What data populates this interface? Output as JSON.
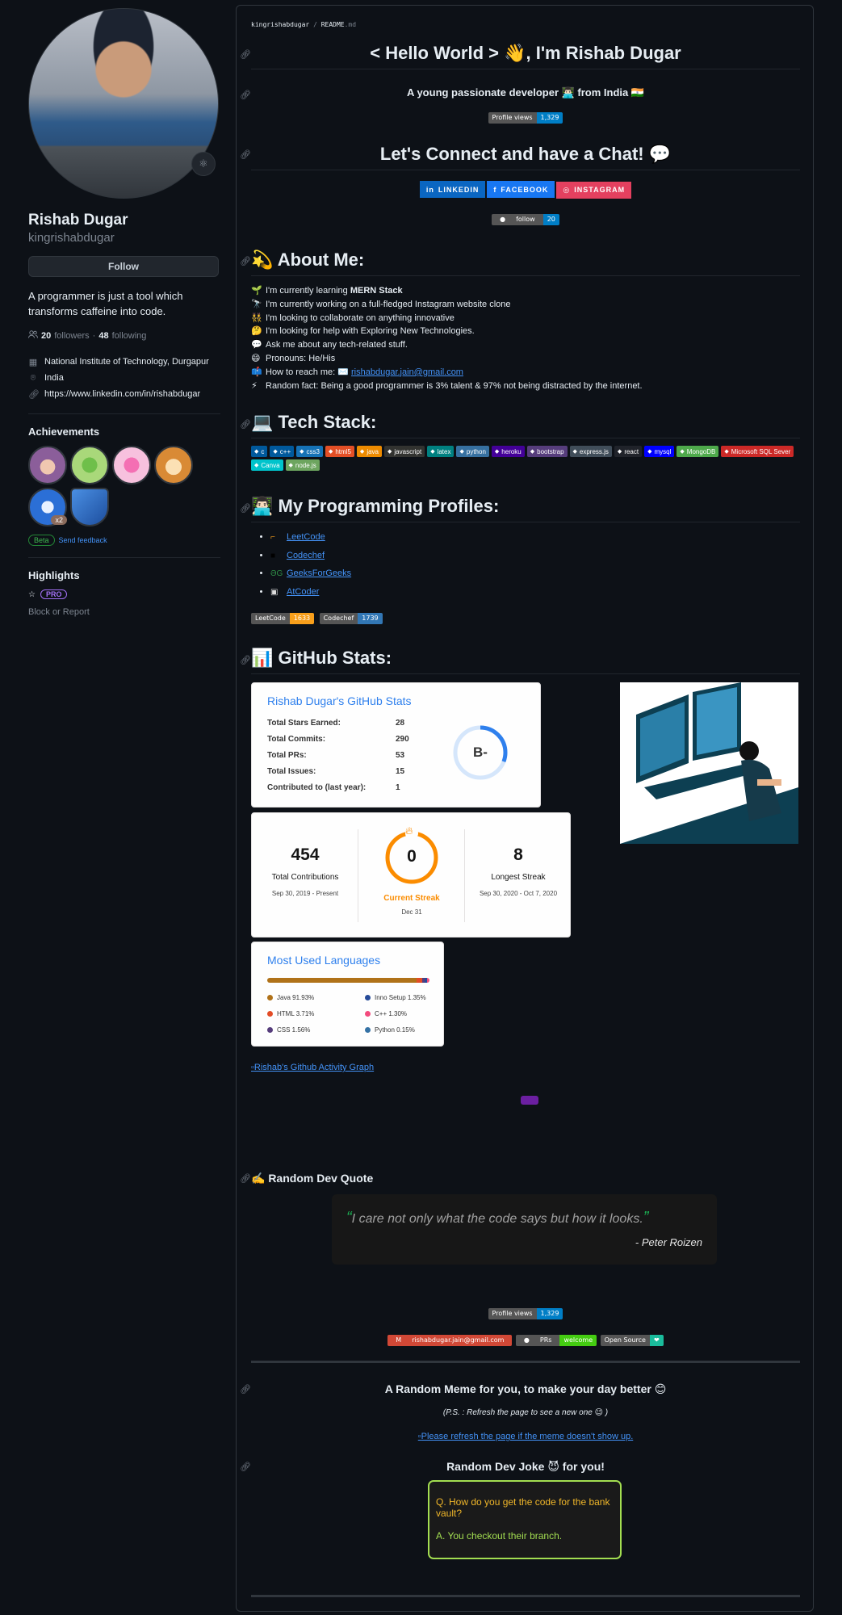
{
  "profile": {
    "name": "Rishab Dugar",
    "login": "kingrishabdugar",
    "follow_label": "Follow",
    "bio": "A programmer is just a tool which transforms caffeine into code.",
    "followers_count": "20",
    "followers_label": "followers",
    "following_count": "48",
    "following_label": "following",
    "separator": "·",
    "organization": "National Institute of Technology, Durgapur",
    "location": "India",
    "link": "https://www.linkedin.com/in/rishabdugar",
    "achievements_heading": "Achievements",
    "achievement_multiplier": "x2",
    "beta_label": "Beta",
    "feedback_label": "Send feedback",
    "highlights_heading": "Highlights",
    "pro_label": "PRO",
    "block_label": "Block or Report"
  },
  "readme": {
    "breadcrumb_user": "kingrishabdugar",
    "breadcrumb_sep": " / ",
    "breadcrumb_file": "README",
    "breadcrumb_ext": ".md",
    "hello_title": "< Hello World > 👋, I'm Rishab Dugar",
    "tagline": "A young passionate developer 👨🏻‍💻 from India 🇮🇳",
    "views_label": "Profile views",
    "views_count": "1,329",
    "connect_title": "Let's Connect and have a Chat! 💬",
    "social": [
      {
        "label": "LINKEDIN",
        "icon": "linkedin-icon",
        "color": "#0a66c2"
      },
      {
        "label": "FACEBOOK",
        "icon": "facebook-icon",
        "color": "#1877f2"
      },
      {
        "label": "INSTAGRAM",
        "icon": "instagram-icon",
        "color": "#e4405f"
      }
    ],
    "follow_badge_label": "follow",
    "follow_badge_count": "20",
    "about_title": "💫 About Me:",
    "about": [
      {
        "emoji": "🌱",
        "pre": "I'm currently learning ",
        "bold": "MERN Stack"
      },
      {
        "emoji": "🔭",
        "pre": "I'm currently working on a full-fledged Instagram website clone"
      },
      {
        "emoji": "👯",
        "pre": "I'm looking to collaborate on anything innovative"
      },
      {
        "emoji": "🤔",
        "pre": "I'm looking for help with Exploring New Technologies."
      },
      {
        "emoji": "💬",
        "pre": "Ask me about any tech-related stuff."
      },
      {
        "emoji": "😄",
        "pre": "Pronouns: He/His"
      },
      {
        "emoji": "📫",
        "pre": "How to reach me: ✉️ ",
        "link": "rishabdugar.jain@gmail.com"
      },
      {
        "emoji": "⚡",
        "pre": "Random fact: Being a good programmer is 3% talent & 97% not being distracted by the internet."
      }
    ],
    "tech_title": "💻 Tech Stack:",
    "tech": [
      {
        "label": "c",
        "color": "#00599c"
      },
      {
        "label": "c++",
        "color": "#00599c"
      },
      {
        "label": "css3",
        "color": "#1572b6"
      },
      {
        "label": "html5",
        "color": "#e34f26"
      },
      {
        "label": "java",
        "color": "#ed8b00"
      },
      {
        "label": "javascript",
        "color": "#323330"
      },
      {
        "label": "latex",
        "color": "#008080"
      },
      {
        "label": "python",
        "color": "#3670a0"
      },
      {
        "label": "heroku",
        "color": "#430098"
      },
      {
        "label": "bootstrap",
        "color": "#563d7c"
      },
      {
        "label": "express.js",
        "color": "#404d59"
      },
      {
        "label": "react",
        "color": "#20232a"
      },
      {
        "label": "mysql",
        "color": "#00f"
      },
      {
        "label": "MongoDB",
        "color": "#4ea94b"
      },
      {
        "label": "Microsoft SQL Sever",
        "color": "#cc2927"
      },
      {
        "label": "Canva",
        "color": "#00c4cc"
      },
      {
        "label": "node.js",
        "color": "#6da55f"
      }
    ],
    "profiles_title": "👨🏻‍💻 My Programming Profiles:",
    "profiles": [
      "LeetCode",
      "Codechef",
      "GeeksForGeeks",
      "AtCoder"
    ],
    "rating_badges": [
      {
        "label": "LeetCode",
        "value": "1633",
        "color": "#f89f1b"
      },
      {
        "label": "Codechef",
        "value": "1739",
        "color": "#3277b5"
      }
    ],
    "stats_title": "📊 GitHub Stats:",
    "github_stats": {
      "title": "Rishab Dugar's GitHub Stats",
      "rows": [
        {
          "label": "Total Stars Earned:",
          "value": "28"
        },
        {
          "label": "Total Commits:",
          "value": "290"
        },
        {
          "label": "Total PRs:",
          "value": "53"
        },
        {
          "label": "Total Issues:",
          "value": "15"
        },
        {
          "label": "Contributed to (last year):",
          "value": "1"
        }
      ],
      "grade": "B-"
    },
    "streak": {
      "total": "454",
      "total_label": "Total Contributions",
      "total_range": "Sep 30, 2019 - Present",
      "current": "0",
      "current_label": "Current Streak",
      "current_date": "Dec 31",
      "longest": "8",
      "longest_label": "Longest Streak",
      "longest_range": "Sep 30, 2020 - Oct 7, 2020"
    },
    "languages": {
      "title": "Most Used Languages",
      "items": [
        {
          "label": "Java 91.93%",
          "color": "#b07219",
          "pct": 91.93
        },
        {
          "label": "Inno Setup 1.35%",
          "color": "#264b99",
          "pct": 1.35
        },
        {
          "label": "HTML 3.71%",
          "color": "#e34c26",
          "pct": 3.71
        },
        {
          "label": "C++ 1.30%",
          "color": "#f34b7d",
          "pct": 1.3
        },
        {
          "label": "CSS 1.56%",
          "color": "#563d7c",
          "pct": 1.56
        },
        {
          "label": "Python 0.15%",
          "color": "#3572a5",
          "pct": 0.15
        }
      ]
    },
    "activity_graph_alt": "Rishab's Github Activity Graph",
    "quote_heading": "✍️ Random Dev Quote",
    "quote": "I care not only what the code says but how it looks.",
    "quote_author": "- Peter Roizen",
    "footer_views_label": "Profile views",
    "footer_views_count": "1,329",
    "email_badge": "rishabdugar.jain@gmail.com",
    "prs_label": "PRs",
    "prs_value": "welcome",
    "open_source_label": "Open Source",
    "open_source_value": "❤",
    "meme_heading": "A Random Meme for you, to make your day better 😊",
    "meme_note": "(P.S. : Refresh the page to see a new one 😉 )",
    "meme_alt": "Please refresh the page if the meme doesn't show up.",
    "joke_heading": "Random Dev Joke 😈 for you!",
    "joke_q": "Q. How do you get the code for the bank vault?",
    "joke_a": "A. You checkout their branch."
  }
}
